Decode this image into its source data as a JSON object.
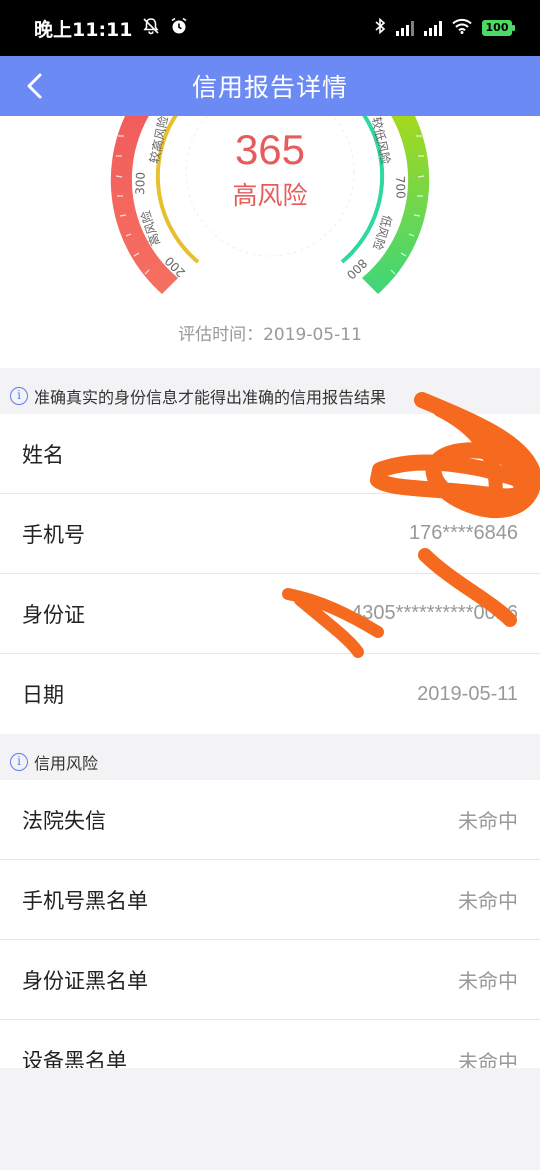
{
  "status_bar": {
    "time": "晚上11:11",
    "battery": "100"
  },
  "nav": {
    "title": "信用报告详情"
  },
  "gauge": {
    "score": "365",
    "risk_level": "高风险",
    "zone_labels": {
      "high_risk": "高风险",
      "higher_risk": "较高风险",
      "lower_risk": "较低风险",
      "low_risk": "低风险"
    },
    "tick_labels": [
      "200",
      "300",
      "700",
      "800"
    ],
    "eval_time": "评估时间：2019-05-11",
    "colors": {
      "red": "#f25c5c",
      "yellow": "#e6c02e",
      "teal": "#2ed8a0",
      "green": "#8fd61c"
    }
  },
  "notice": {
    "text": "准确真实的身份信息才能得出准确的信用报告结果"
  },
  "identity": [
    {
      "label": "姓名",
      "value": ""
    },
    {
      "label": "手机号",
      "value": "176****6846"
    },
    {
      "label": "身份证",
      "value": "4305**********0016"
    },
    {
      "label": "日期",
      "value": "2019-05-11"
    }
  ],
  "credit_section": {
    "title": "信用风险",
    "items": [
      {
        "label": "法院失信",
        "value": "未命中"
      },
      {
        "label": "手机号黑名单",
        "value": "未命中"
      },
      {
        "label": "身份证黑名单",
        "value": "未命中"
      },
      {
        "label": "设备黑名单",
        "value": "未命中"
      }
    ]
  },
  "accent_color": "#6b8af4"
}
